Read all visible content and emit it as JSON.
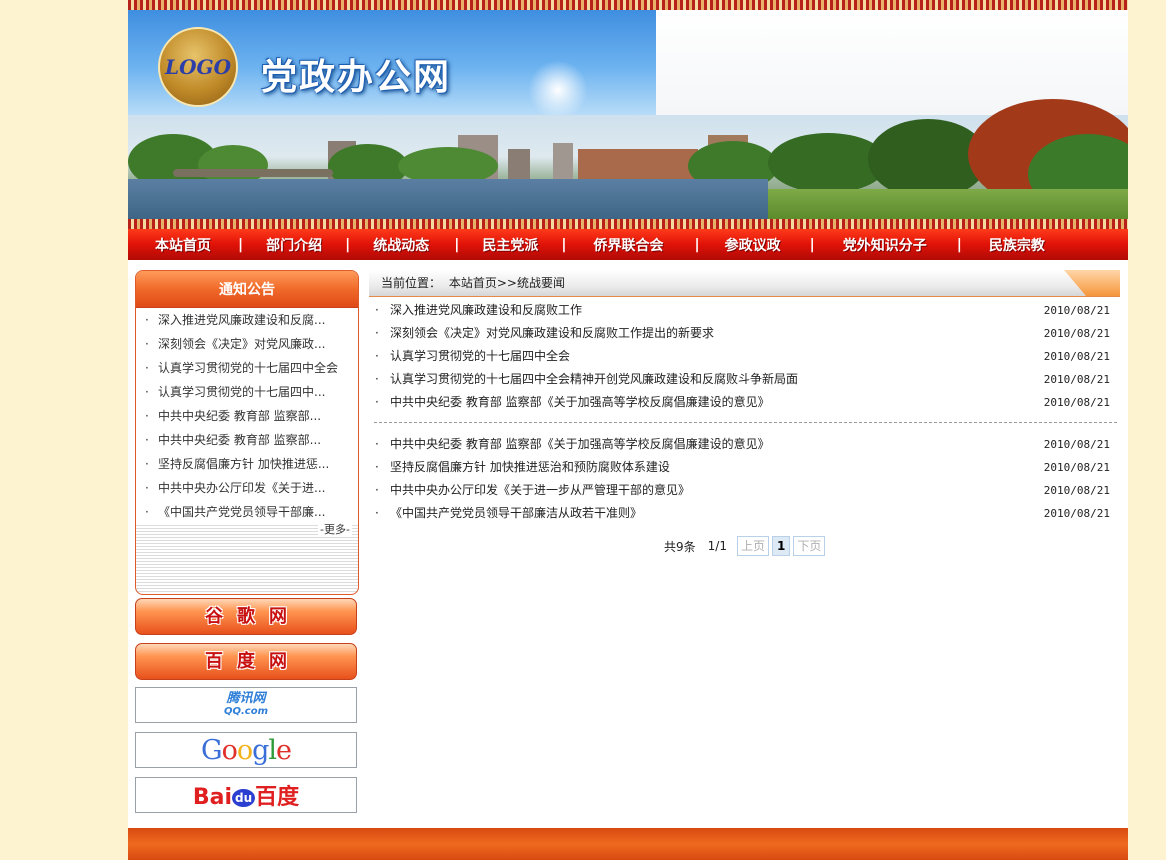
{
  "header": {
    "logo_text": "LOGO",
    "site_title": "党政办公网"
  },
  "nav": {
    "items": [
      "本站首页",
      "部门介绍",
      "统战动态",
      "民主党派",
      "侨界联合会",
      "参政议政",
      "党外知识分子",
      "民族宗教"
    ],
    "separator": "|"
  },
  "sidebar": {
    "notice_title": "通知公告",
    "notices": [
      "深入推进党风廉政建设和反腐...",
      "深刻领会《决定》对党风廉政...",
      "认真学习贯彻党的十七届四中全会",
      "认真学习贯彻党的十七届四中...",
      "中共中央纪委 教育部 监察部...",
      "中共中央纪委 教育部 监察部...",
      "坚持反腐倡廉方针 加快推进惩...",
      "中共中央办公厅印发《关于进...",
      "《中国共产党党员领导干部廉..."
    ],
    "bullet": "·",
    "more": "-更多-",
    "button_google": "谷歌网",
    "button_baidu": "百度网",
    "link_qq": {
      "line1": "腾讯网",
      "line2": "QQ.com"
    },
    "link_google": "Google",
    "link_baidu": {
      "bai": "Bai",
      "du": "du",
      "cn": "百度"
    }
  },
  "main": {
    "breadcrumb_label": "当前位置：",
    "breadcrumb_path": "本站首页>>统战要闻",
    "bullet": "·",
    "news_group1": [
      {
        "title": "深入推进党风廉政建设和反腐败工作",
        "date": "2010/08/21"
      },
      {
        "title": "深刻领会《决定》对党风廉政建设和反腐败工作提出的新要求",
        "date": "2010/08/21"
      },
      {
        "title": "认真学习贯彻党的十七届四中全会",
        "date": "2010/08/21"
      },
      {
        "title": "认真学习贯彻党的十七届四中全会精神开创党风廉政建设和反腐败斗争新局面",
        "date": "2010/08/21"
      },
      {
        "title": "中共中央纪委 教育部 监察部《关于加强高等学校反腐倡廉建设的意见》",
        "date": "2010/08/21"
      }
    ],
    "news_group2": [
      {
        "title": "中共中央纪委 教育部 监察部《关于加强高等学校反腐倡廉建设的意见》",
        "date": "2010/08/21"
      },
      {
        "title": "坚持反腐倡廉方针 加快推进惩治和预防腐败体系建设",
        "date": "2010/08/21"
      },
      {
        "title": "中共中央办公厅印发《关于进一步从严管理干部的意见》",
        "date": "2010/08/21"
      },
      {
        "title": "《中国共产党党员领导干部廉洁从政若干准则》",
        "date": "2010/08/21"
      }
    ],
    "pager": {
      "total": "共9条",
      "page_info": "1/1",
      "prev": "上页",
      "current": "1",
      "next": "下页"
    }
  },
  "colors": {
    "page_bg": "#fef3d0",
    "nav_red": "#e01208",
    "accent_orange": "#f06a2a"
  }
}
